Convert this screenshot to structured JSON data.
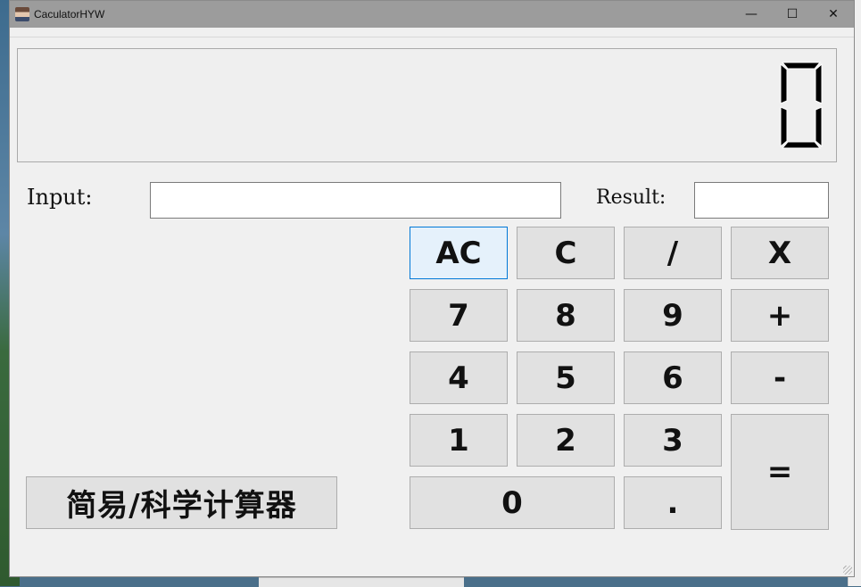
{
  "window": {
    "title": "CaculatorHYW"
  },
  "titlebar": {
    "minimize": "—",
    "maximize": "☐",
    "close": "✕"
  },
  "display": {
    "value": "0"
  },
  "inputs": {
    "input_label": "Input:",
    "result_label": "Result:",
    "input_value": "",
    "result_value": ""
  },
  "buttons": {
    "ac": "AC",
    "c": "C",
    "divide": "/",
    "multiply": "X",
    "seven": "7",
    "eight": "8",
    "nine": "9",
    "plus": "+",
    "four": "4",
    "five": "5",
    "six": "6",
    "minus": "-",
    "one": "1",
    "two": "2",
    "three": "3",
    "equals": "=",
    "zero": "0",
    "dot": ".",
    "mode": "简易/科学计算器"
  },
  "colors": {
    "titlebar": "#9c9c9c",
    "window": "#f0f0f0",
    "button": "#e1e1e1",
    "button_active": "#e5f1fb",
    "focus_border": "#0078d7"
  }
}
